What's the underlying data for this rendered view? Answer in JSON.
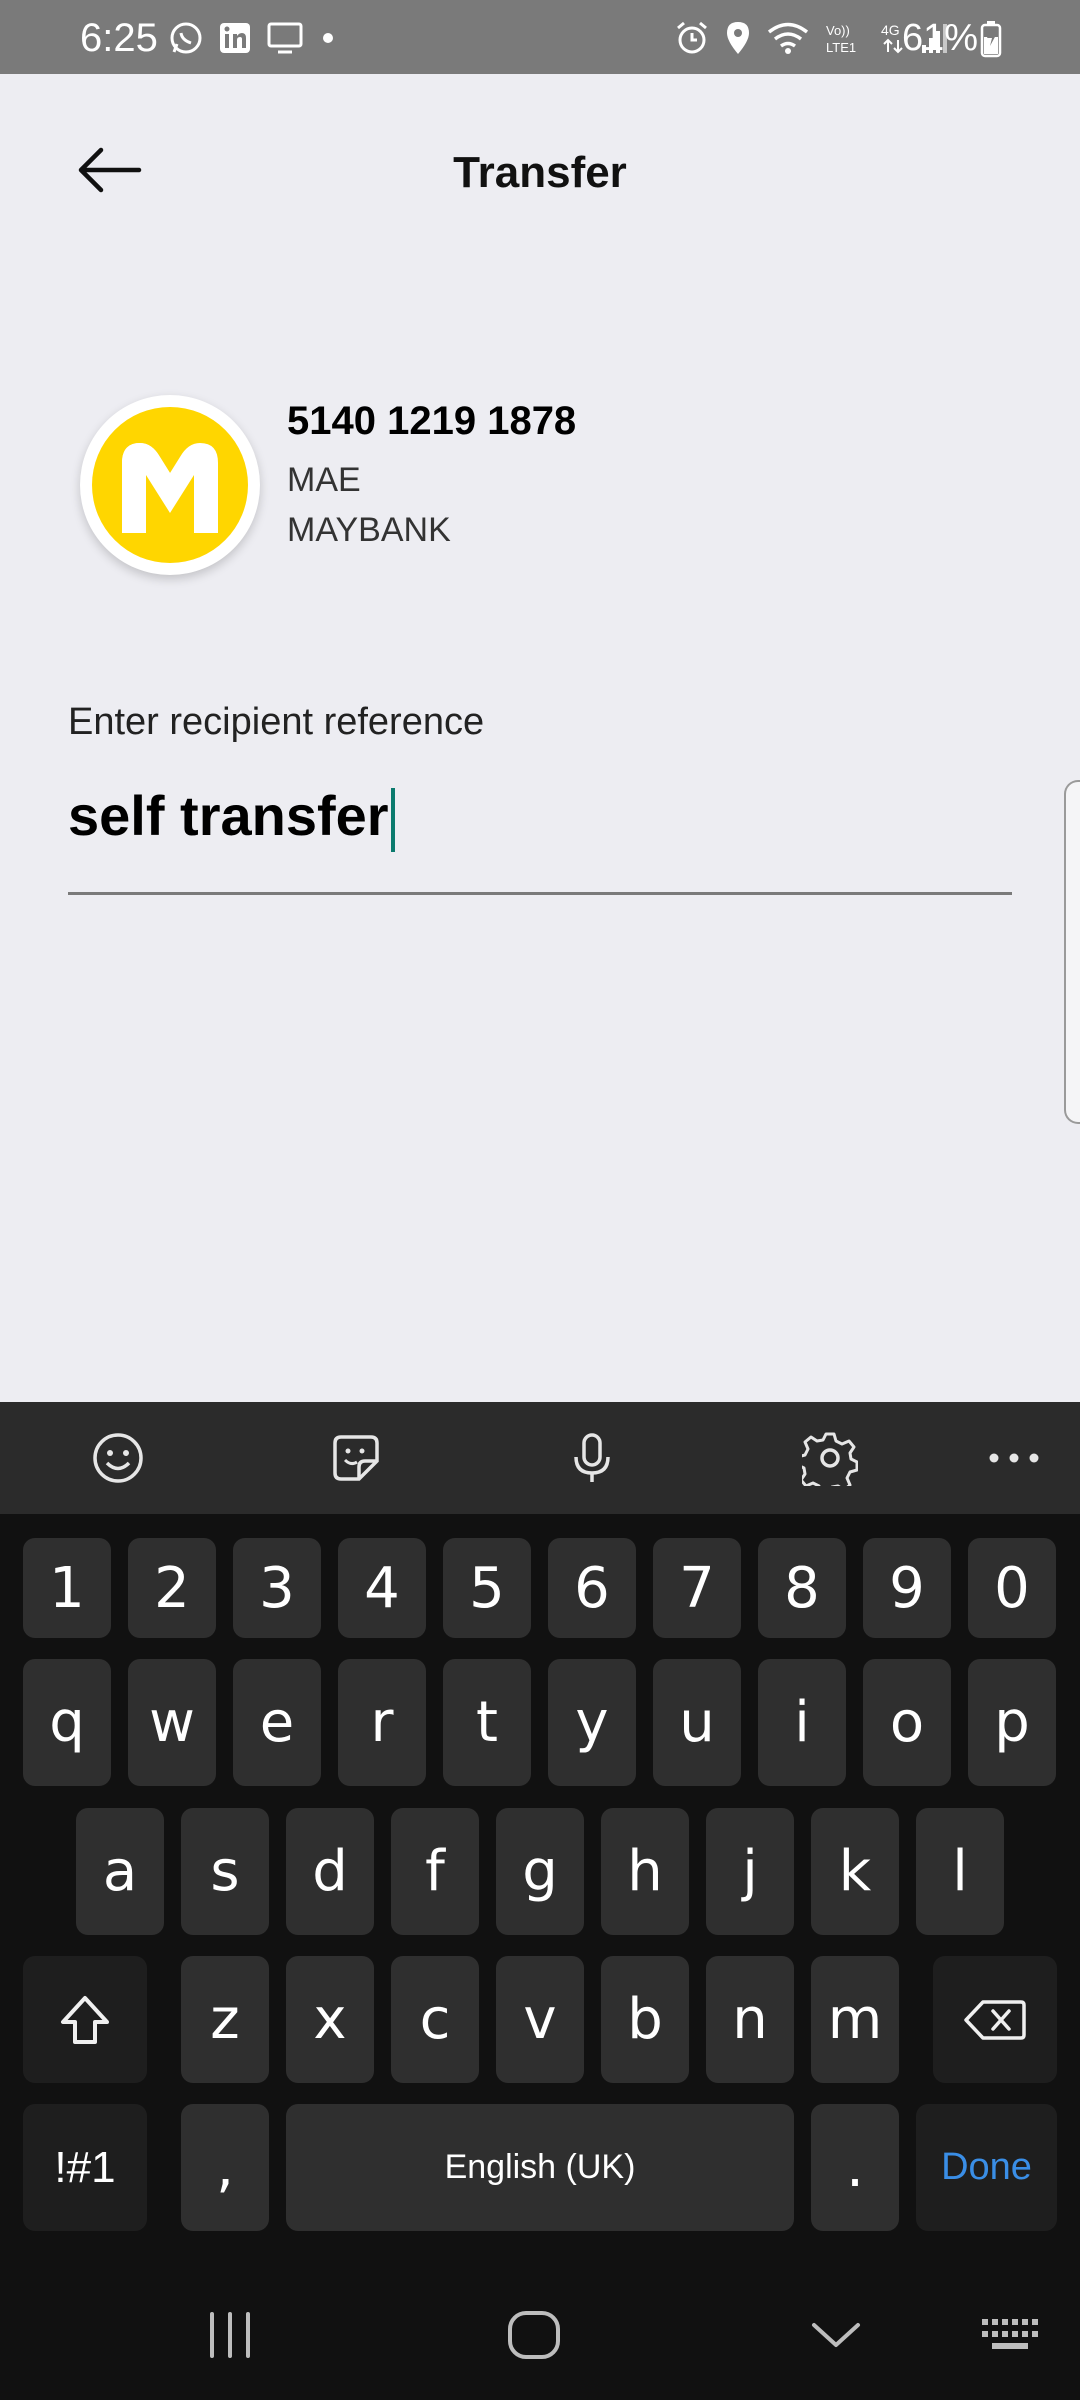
{
  "status_bar": {
    "time": "6:25",
    "battery": "61%",
    "icons_left": [
      "whatsapp-icon",
      "linkedin-icon",
      "cast-icon",
      "dot-icon"
    ],
    "icons_right": [
      "alarm-icon",
      "location-icon",
      "wifi-icon",
      "volte-icon",
      "signal-icon",
      "battery-icon"
    ],
    "volte_label": "VoLTE1",
    "network_label": "4G"
  },
  "header": {
    "title": "Transfer",
    "back_icon": "arrow-left-icon"
  },
  "recipient": {
    "account_number": "5140 1219 1878",
    "account_type": "MAE",
    "bank_name": "MAYBANK",
    "logo_letter": "M",
    "logo_color": "#FFD600"
  },
  "reference": {
    "label": "Enter recipient reference",
    "value": "self transfer",
    "caret_color": "#0b7a6e"
  },
  "keyboard": {
    "toolbar": [
      "emoji-icon",
      "sticker-icon",
      "microphone-icon",
      "settings-icon",
      "more-icon"
    ],
    "row_numbers": [
      "1",
      "2",
      "3",
      "4",
      "5",
      "6",
      "7",
      "8",
      "9",
      "0"
    ],
    "row_1": [
      "q",
      "w",
      "e",
      "r",
      "t",
      "y",
      "u",
      "i",
      "o",
      "p"
    ],
    "row_2": [
      "a",
      "s",
      "d",
      "f",
      "g",
      "h",
      "j",
      "k",
      "l"
    ],
    "row_3": [
      "z",
      "x",
      "c",
      "v",
      "b",
      "n",
      "m"
    ],
    "symbols_label": "!#1",
    "comma_label": ",",
    "space_label": "English (UK)",
    "period_label": ".",
    "done_label": "Done",
    "done_color": "#3a8ee6"
  },
  "nav_bar": {
    "buttons": [
      "recent-apps-icon",
      "home-icon",
      "back-chevron-icon",
      "keyboard-icon"
    ]
  }
}
